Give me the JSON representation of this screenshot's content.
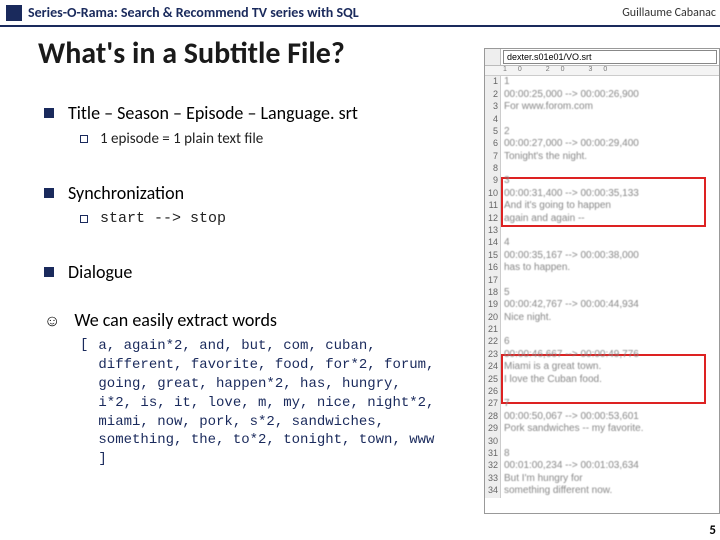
{
  "header": {
    "title": "Series-O-Rama: Search & Recommend TV series with SQL",
    "author": "Guillaume Cabanac"
  },
  "slide_title": "What's in a Subtitle File?",
  "bullets": {
    "b1": {
      "text": "Title – Season – Episode – Language. srt"
    },
    "b1sub": {
      "text": "1 episode = 1 plain text file"
    },
    "b2": {
      "text": "Synchronization"
    },
    "b2sub": {
      "text": "start --> stop"
    },
    "b3": {
      "text": "Dialogue"
    },
    "smile": {
      "text": "We can easily extract words"
    },
    "words": {
      "open": "[",
      "list": "a, again*2, and, but, com, cuban, different, favorite, food, for*2, forum, going, great, happen*2, has, hungry, i*2, is, it, love, m, my, nice, night*2, miami, now, pork, s*2, sandwiches, something, the, to*2, tonight, town, www ]"
    }
  },
  "right": {
    "filename": "dexter.s01e01/VO.srt",
    "ruler": "10 20 30",
    "lines": [
      {
        "n": "1",
        "t": "1"
      },
      {
        "n": "2",
        "t": "00:00:25,000 --> 00:00:26,900"
      },
      {
        "n": "3",
        "t": "For www.forom.com"
      },
      {
        "n": "4",
        "t": ""
      },
      {
        "n": "5",
        "t": "2"
      },
      {
        "n": "6",
        "t": "00:00:27,000 --> 00:00:29,400"
      },
      {
        "n": "7",
        "t": "Tonight's the night."
      },
      {
        "n": "8",
        "t": ""
      },
      {
        "n": "9",
        "t": "3"
      },
      {
        "n": "10",
        "t": "00:00:31,400 --> 00:00:35,133"
      },
      {
        "n": "11",
        "t": "And it's going to happen"
      },
      {
        "n": "12",
        "t": "again and again --"
      },
      {
        "n": "13",
        "t": ""
      },
      {
        "n": "14",
        "t": "4"
      },
      {
        "n": "15",
        "t": "00:00:35,167 --> 00:00:38,000"
      },
      {
        "n": "16",
        "t": "has to happen."
      },
      {
        "n": "17",
        "t": ""
      },
      {
        "n": "18",
        "t": "5"
      },
      {
        "n": "19",
        "t": "00:00:42,767 --> 00:00:44,934"
      },
      {
        "n": "20",
        "t": "Nice night."
      },
      {
        "n": "21",
        "t": ""
      },
      {
        "n": "22",
        "t": "6"
      },
      {
        "n": "23",
        "t": "00:00:46,667 --> 00:00:49,776"
      },
      {
        "n": "24",
        "t": "Miami is a great town."
      },
      {
        "n": "25",
        "t": "I love the Cuban food."
      },
      {
        "n": "26",
        "t": ""
      },
      {
        "n": "27",
        "t": "7"
      },
      {
        "n": "28",
        "t": "00:00:50,067 --> 00:00:53,601"
      },
      {
        "n": "29",
        "t": "Pork sandwiches -- my favorite."
      },
      {
        "n": "30",
        "t": ""
      },
      {
        "n": "31",
        "t": "8"
      },
      {
        "n": "32",
        "t": "00:01:00,234 --> 00:01:03,634"
      },
      {
        "n": "33",
        "t": "But I'm hungry for"
      },
      {
        "n": "34",
        "t": "something different now."
      }
    ]
  },
  "pagenum": "5"
}
